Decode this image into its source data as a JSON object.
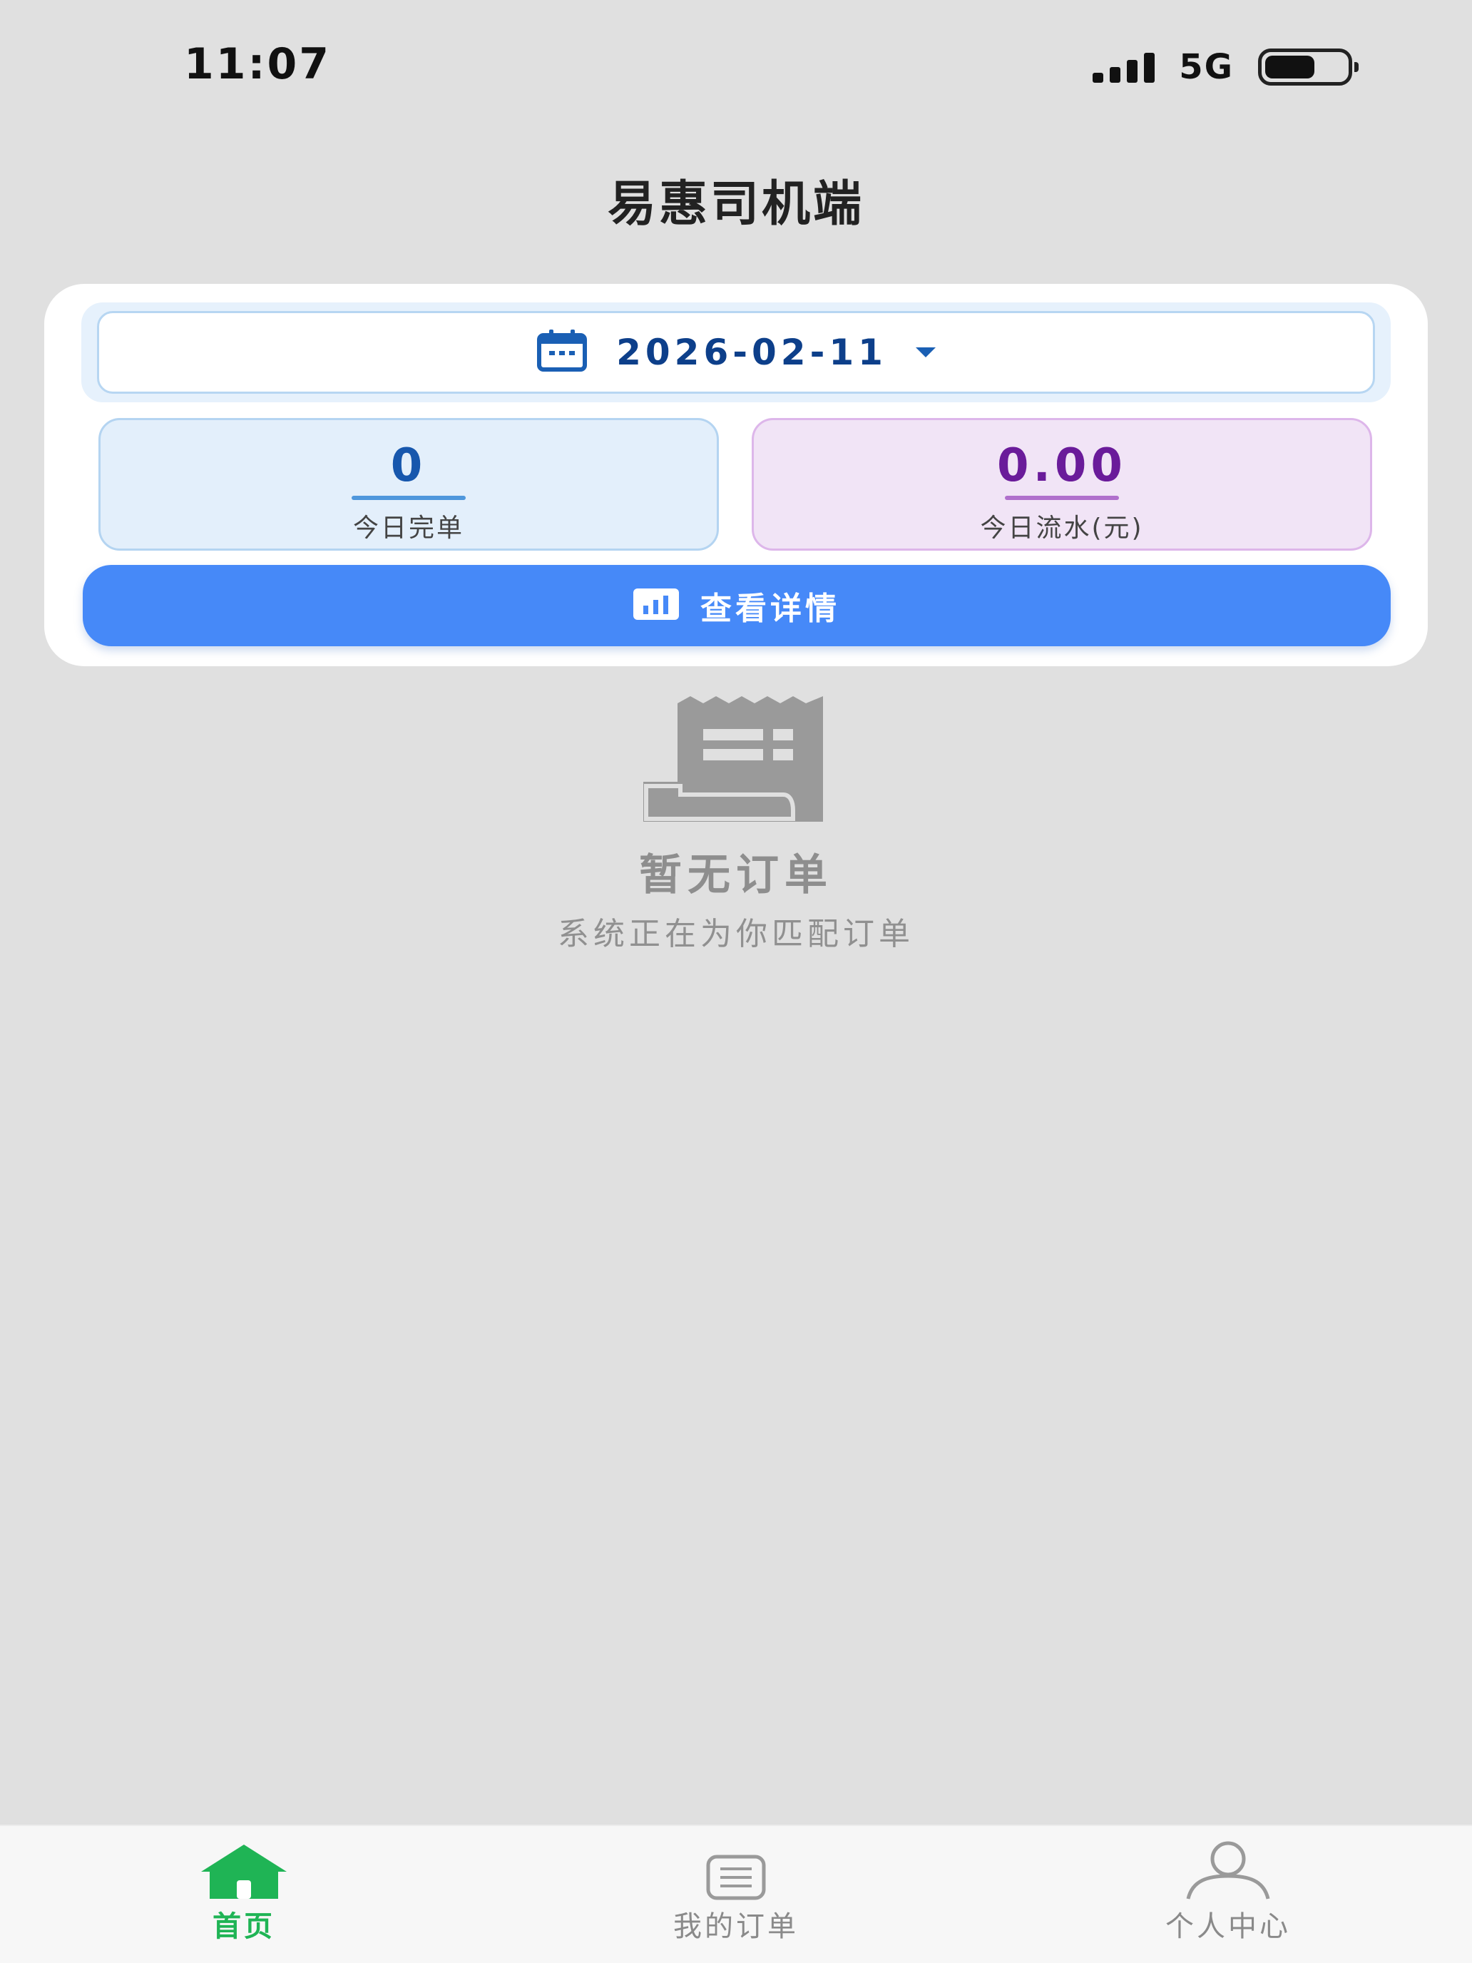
{
  "status": {
    "time": "11:07",
    "network": "5G"
  },
  "app": {
    "title": "易惠司机端"
  },
  "date_selector": {
    "date": "2026-02-11"
  },
  "stats": {
    "orders": {
      "value": "0",
      "label": "今日完单"
    },
    "income": {
      "value": "0.00",
      "label": "今日流水(元)"
    }
  },
  "details_button": {
    "label": "查看详情"
  },
  "empty_state": {
    "title": "暂无订单",
    "subtitle": "系统正在为你匹配订单"
  },
  "tabs": [
    {
      "label": "首页",
      "icon": "home-icon",
      "active": true
    },
    {
      "label": "我的订单",
      "icon": "order-list-icon",
      "active": false
    },
    {
      "label": "个人中心",
      "icon": "user-icon",
      "active": false
    }
  ],
  "colors": {
    "primary_button": "#4689f8",
    "active_tab": "#1fb455",
    "orders_value": "#1757ad",
    "income_value": "#6a1b9a"
  }
}
